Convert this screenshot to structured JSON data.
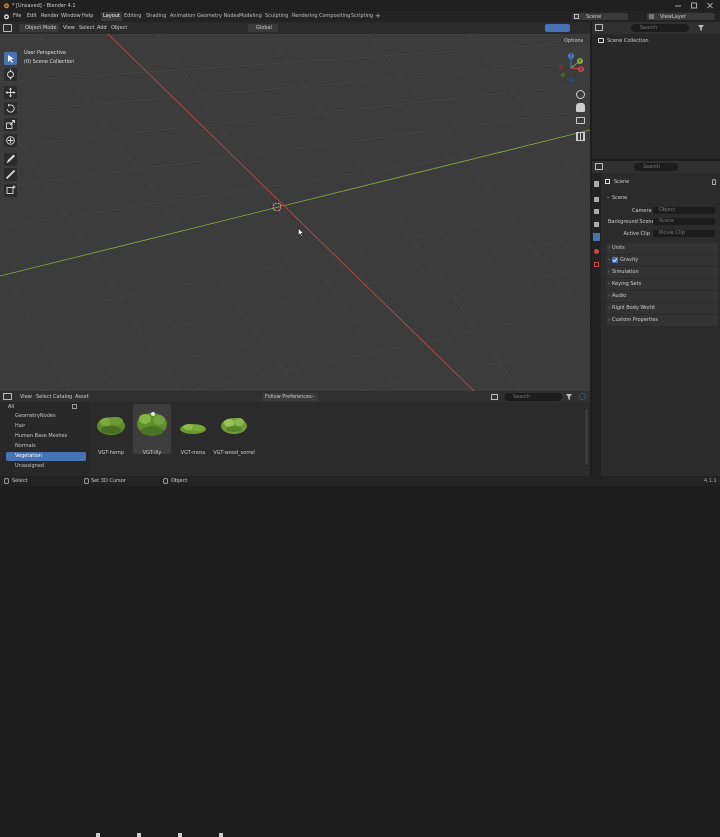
{
  "window": {
    "title": "* [Unsaved] - Blender 4.1",
    "controls": [
      "minimize",
      "maximize",
      "close"
    ]
  },
  "menu": {
    "items": [
      "File",
      "Edit",
      "Render",
      "Window",
      "Help"
    ]
  },
  "workspaces": {
    "tabs": [
      "Layout",
      "Editing",
      "Shading",
      "Animation",
      "Geometry Nodes",
      "Modeling",
      "Sculpting",
      "Rendering",
      "Compositing",
      "Scripting"
    ],
    "active": "Layout",
    "add": "+"
  },
  "scene_selector": {
    "label": "Scene"
  },
  "viewlayer_selector": {
    "label": "ViewLayer"
  },
  "viewport_header": {
    "mode": "Object Mode",
    "menus": [
      "View",
      "Select",
      "Add",
      "Object"
    ],
    "orientation": "Global",
    "options_label": "Options"
  },
  "viewport": {
    "perspective_label": "User Perspective",
    "collection_label": "(0) Scene Collection",
    "gizmo": {
      "x": "X",
      "y": "Y",
      "z": "Z"
    }
  },
  "outliner": {
    "search_placeholder": "Search",
    "root": "Scene Collection"
  },
  "properties": {
    "search_placeholder": "Search",
    "header_title": "Scene",
    "panel_title": "Scene",
    "fields": [
      {
        "label": "Camera",
        "placeholder": "Object"
      },
      {
        "label": "Background Scene",
        "placeholder": "Scene"
      },
      {
        "label": "Active Clip",
        "placeholder": "Movie Clip"
      }
    ],
    "panels": [
      "Units",
      "Gravity",
      "Simulation",
      "Keying Sets",
      "Audio",
      "Rigid Body World",
      "Custom Properties"
    ],
    "gravity_checked": true
  },
  "asset_browser": {
    "menus": [
      "View",
      "Select",
      "Catalog",
      "Asset"
    ],
    "library": "Follow Preferences",
    "search_placeholder": "Search",
    "categories_root": "All",
    "categories": [
      "GeometryNodes",
      "Hair",
      "Human Base Meshes",
      "Normals",
      "Vegetation",
      "Unassigned"
    ],
    "active_category": "Vegetation",
    "assets": [
      {
        "name": "VGT-hemp",
        "selected": false
      },
      {
        "name": "VGT-lily",
        "selected": true
      },
      {
        "name": "VGT-moss",
        "selected": false
      },
      {
        "name": "VGT-wood_sorrel",
        "selected": false
      }
    ]
  },
  "status_bar": {
    "items": [
      "Select",
      "Set 3D Cursor",
      "Object"
    ],
    "version": "4.1.1"
  },
  "colors": {
    "accent": "#4772b3",
    "x_axis": "#c64a4a",
    "y_axis": "#8aab3c",
    "z_axis": "#4a7fd1",
    "viewport_bg": "#3c3c3c"
  }
}
